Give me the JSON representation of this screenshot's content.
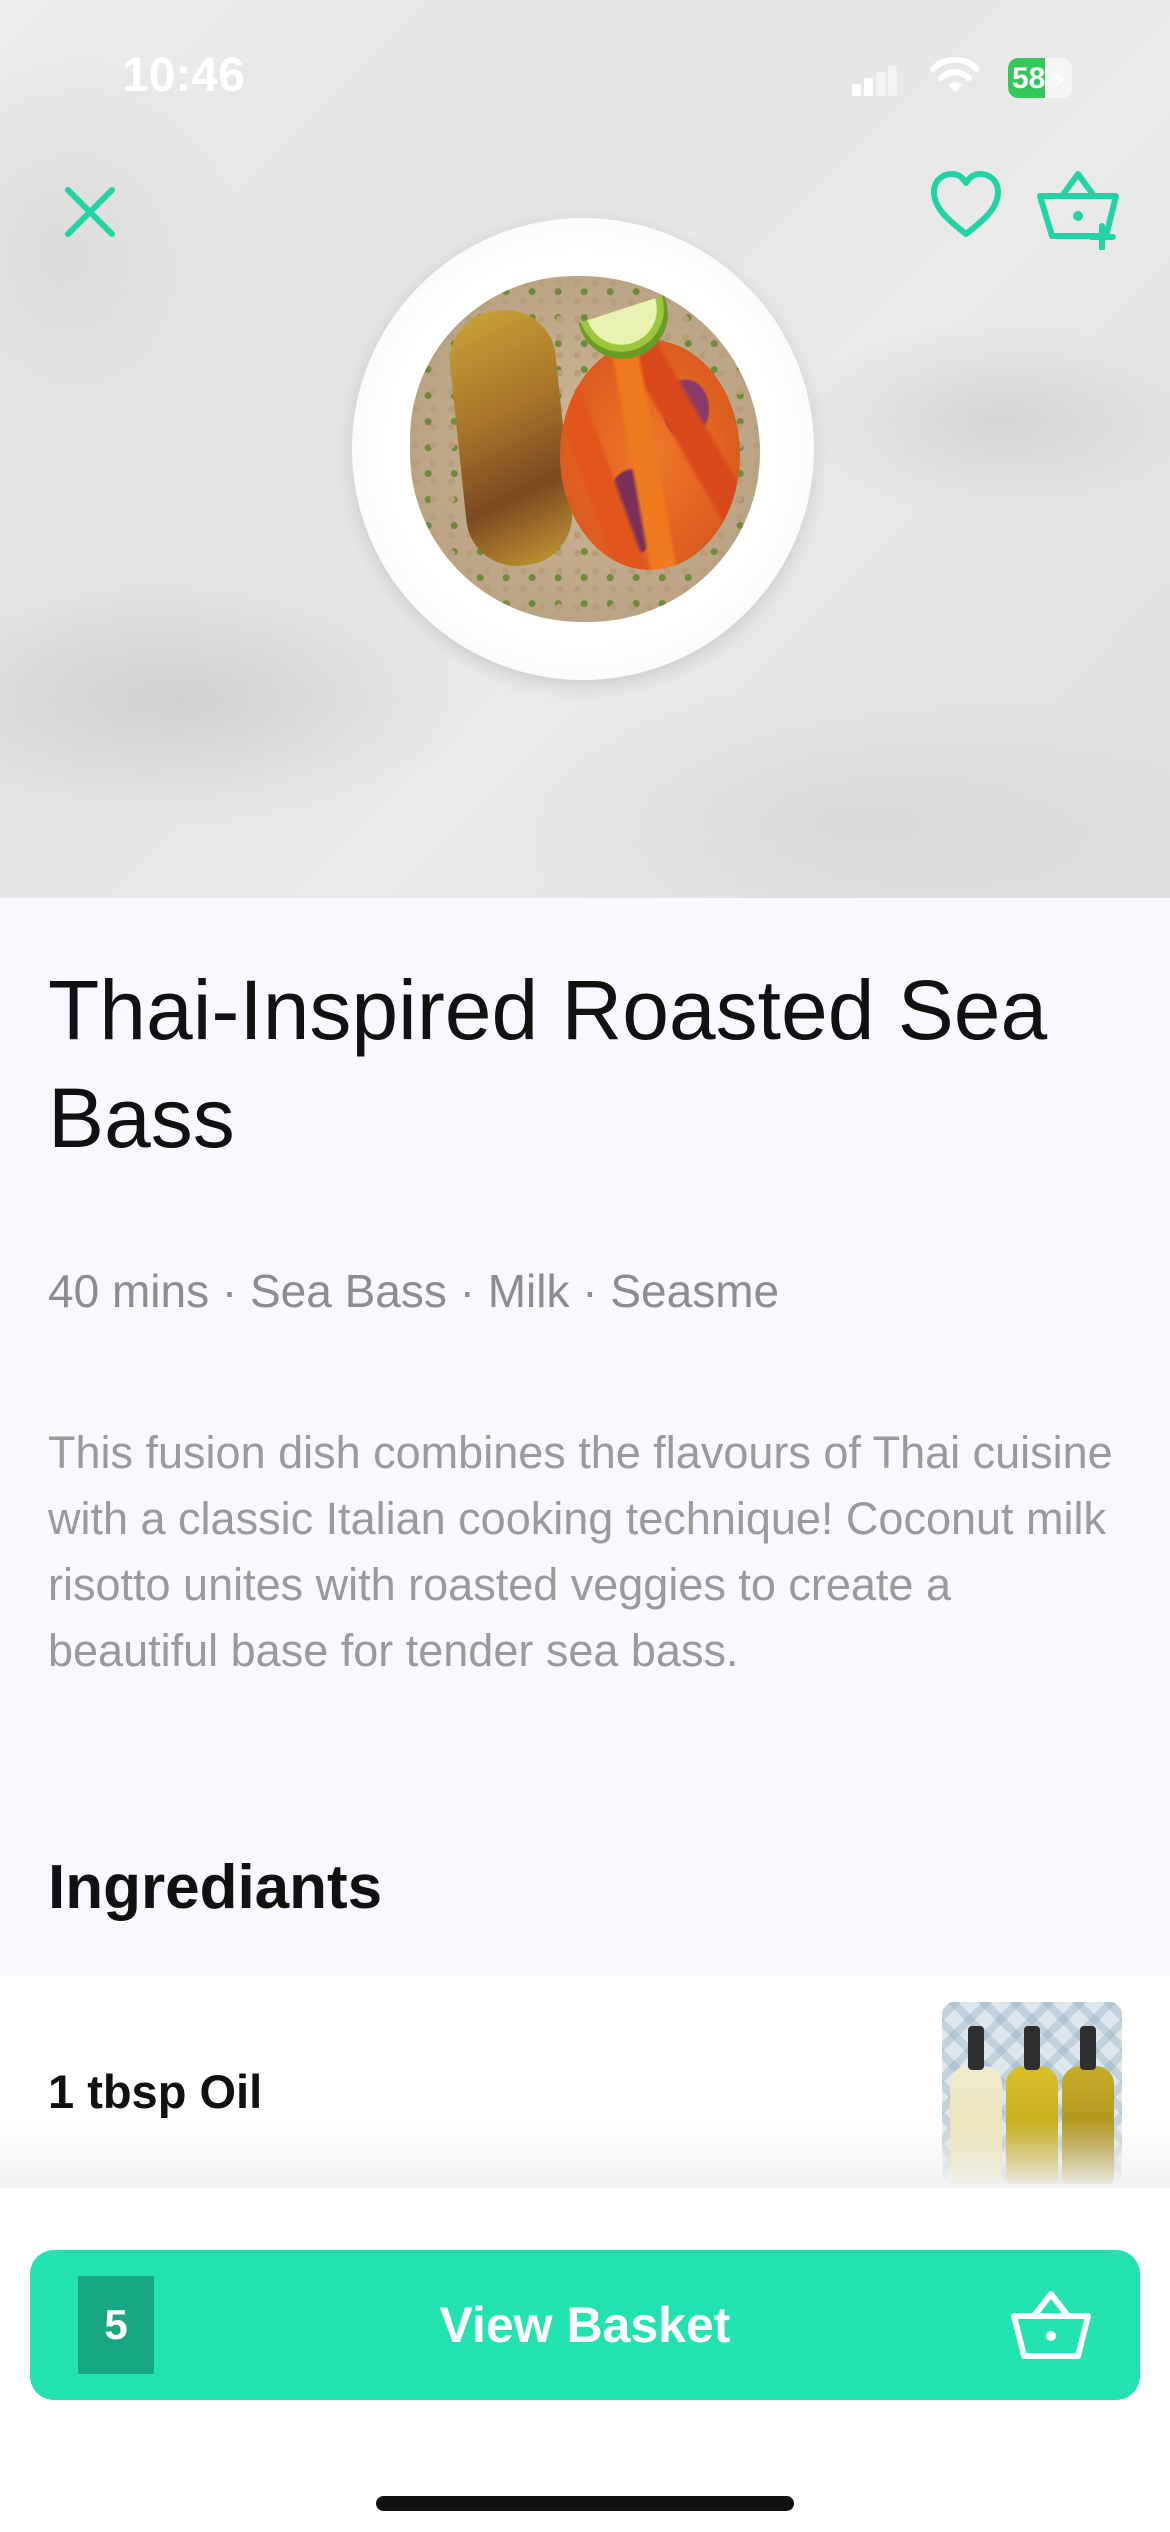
{
  "status_bar": {
    "time": "10:46",
    "battery": "58"
  },
  "recipe": {
    "title": "Thai-Inspired Roasted Sea Bass",
    "meta": "40 mins · Sea Bass · Milk · Seasme",
    "description": "This fusion dish combines the flavours of Thai cuisine with a classic Italian cooking technique! Coconut milk risotto unites with roasted veggies to create a beautiful base for tender sea bass."
  },
  "ingredients": {
    "heading": "Ingrediants",
    "items": [
      {
        "label": "1 tbsp Oil",
        "image_icon": "oil-bottles-image"
      }
    ]
  },
  "basket": {
    "count": "5",
    "label": "View Basket"
  },
  "icons": {
    "close": "close-icon",
    "favorite": "heart-icon",
    "add_to_basket": "basket-add-icon",
    "basket": "basket-icon"
  },
  "colors": {
    "accent": "#22e2b0",
    "accent_dark": "#17a883",
    "title_text": "#111111",
    "muted_text": "#9a9a9a",
    "background": "#f9f7ff"
  }
}
